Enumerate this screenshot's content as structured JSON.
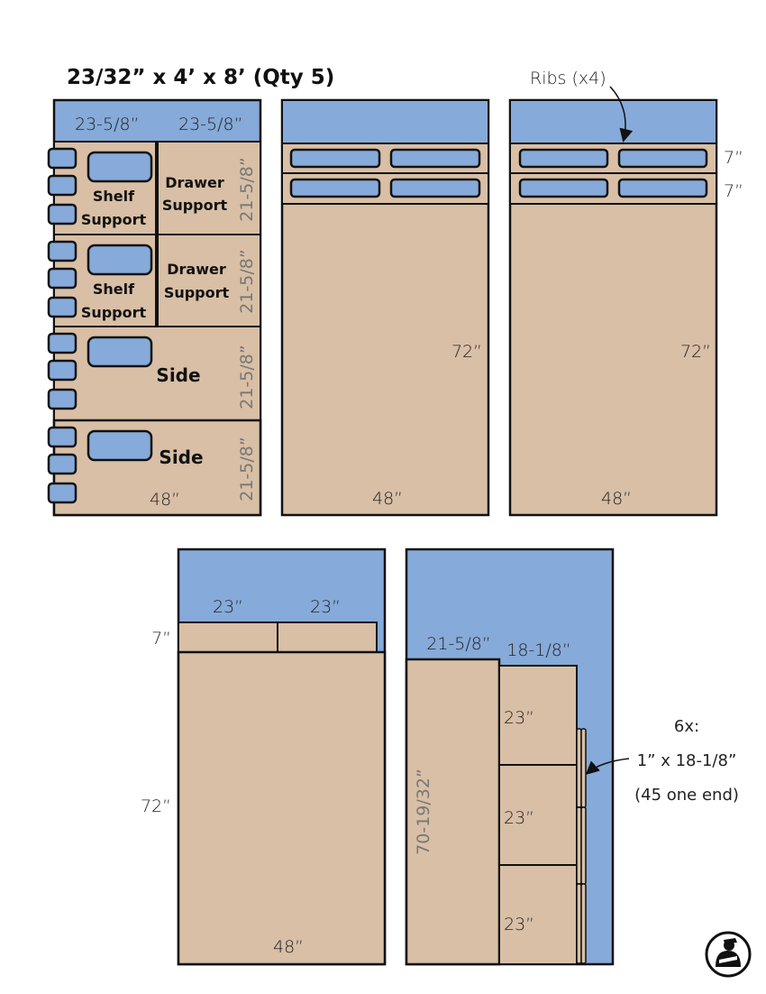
{
  "title": "23/32” x 4’ x 8’ (Qty 5)",
  "colors": {
    "scrap": "#86aad9",
    "wood": "#d8bfa5",
    "outline": "#111111",
    "label_gray": "#777777"
  },
  "sheet1": {
    "top_dims": [
      "23-5/8”",
      "23-5/8”"
    ],
    "pieces": [
      {
        "label_line1": "Shelf",
        "label_line2": "Support"
      },
      {
        "label_line1": "Drawer",
        "label_line2": "Support"
      },
      {
        "label_line1": "Shelf",
        "label_line2": "Support"
      },
      {
        "label_line1": "Drawer",
        "label_line2": "Support"
      },
      {
        "label_line1": "Side"
      },
      {
        "label_line1": "Side"
      }
    ],
    "row_dims": [
      "21-5/8”",
      "21-5/8”",
      "21-5/8”",
      "21-5/8”"
    ],
    "width_dim": "48”"
  },
  "sheet2": {
    "length_dim": "72”",
    "width_dim": "48”"
  },
  "sheet3": {
    "callout": "Ribs (x4)",
    "rib_dims": [
      "7”",
      "7”"
    ],
    "length_dim": "72”",
    "width_dim": "48”"
  },
  "sheet4": {
    "top_dims": [
      "23”",
      "23”"
    ],
    "strip_dim": "7”",
    "length_dim": "72”",
    "width_dim": "48”"
  },
  "sheet5": {
    "top_dims": [
      "21-5/8”",
      "18-1/8”"
    ],
    "long_dim": "70-19/32”",
    "panel_dims": [
      "23”",
      "23”",
      "23”"
    ],
    "callout_lines": [
      "6x:",
      "1” x 18-1/8”",
      "(45 one end)"
    ]
  },
  "logo": "carpenter-logo-icon"
}
